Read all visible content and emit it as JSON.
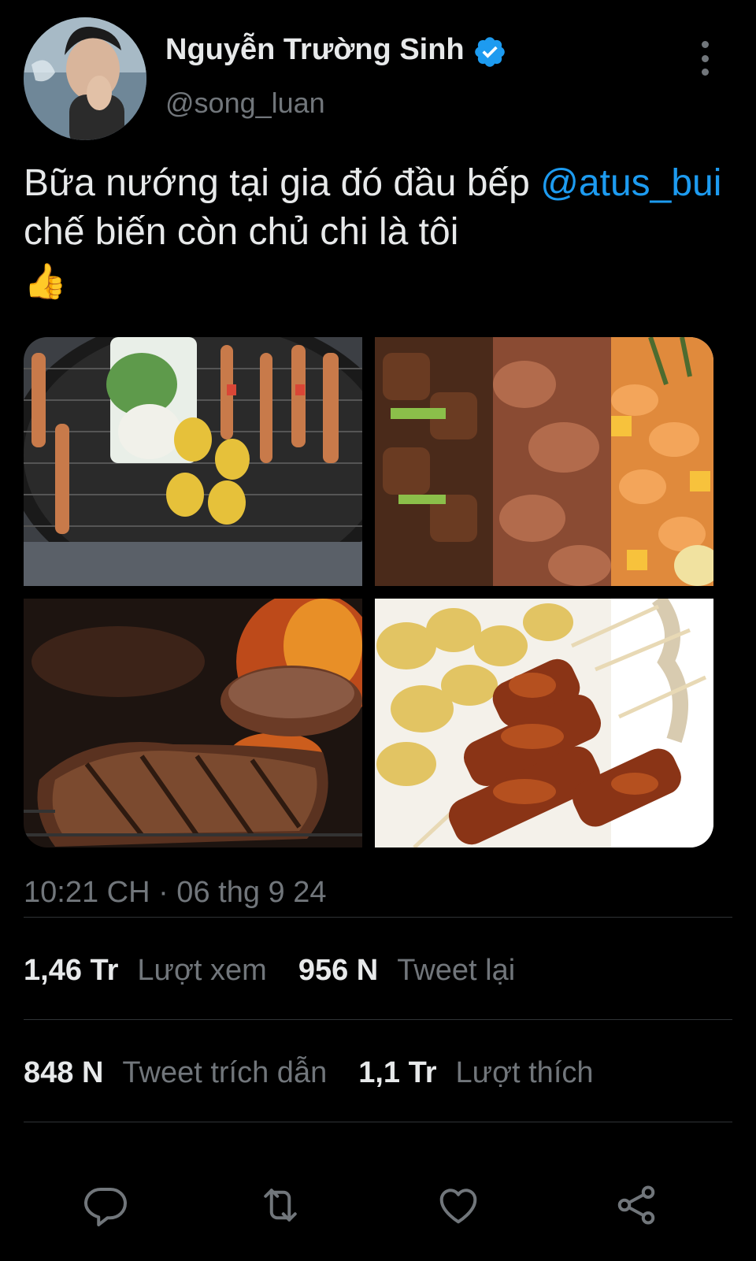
{
  "author": {
    "display_name": "Nguyễn Trường Sinh",
    "handle": "@song_luan",
    "verified": true,
    "verified_color": "#1d9bf0"
  },
  "tweet": {
    "mention": "@atus_bui",
    "text_before_mention": "Bữa nướng tại gia đó đầu bếp ",
    "text_after_mention": " chế biến còn  chủ chi là tôi",
    "emoji": "👍",
    "timestamp": "10:21 CH · 06 thg 9 24",
    "media": [
      {
        "name": "grill-skewers-corn-photo"
      },
      {
        "name": "chicken-shrimp-skewers-photo"
      },
      {
        "name": "steak-on-fire-grill-photo"
      },
      {
        "name": "chicken-skewers-potatoes-photo"
      }
    ]
  },
  "stats": {
    "views_count": "1,46 Tr",
    "views_label": "Lượt xem",
    "retweets_count": "956 N",
    "retweets_label": "Tweet lại",
    "quotes_count": "848 N",
    "quotes_label": "Tweet trích dẫn",
    "likes_count": "1,1 Tr",
    "likes_label": "Lượt thích"
  },
  "actions": [
    {
      "icon": "reply-icon"
    },
    {
      "icon": "retweet-icon"
    },
    {
      "icon": "like-icon"
    },
    {
      "icon": "share-icon"
    }
  ],
  "colors": {
    "background": "#000000",
    "text": "#e7e9ea",
    "secondary_text": "#71767b",
    "link": "#1d9bf0",
    "divider": "#2f3336"
  }
}
